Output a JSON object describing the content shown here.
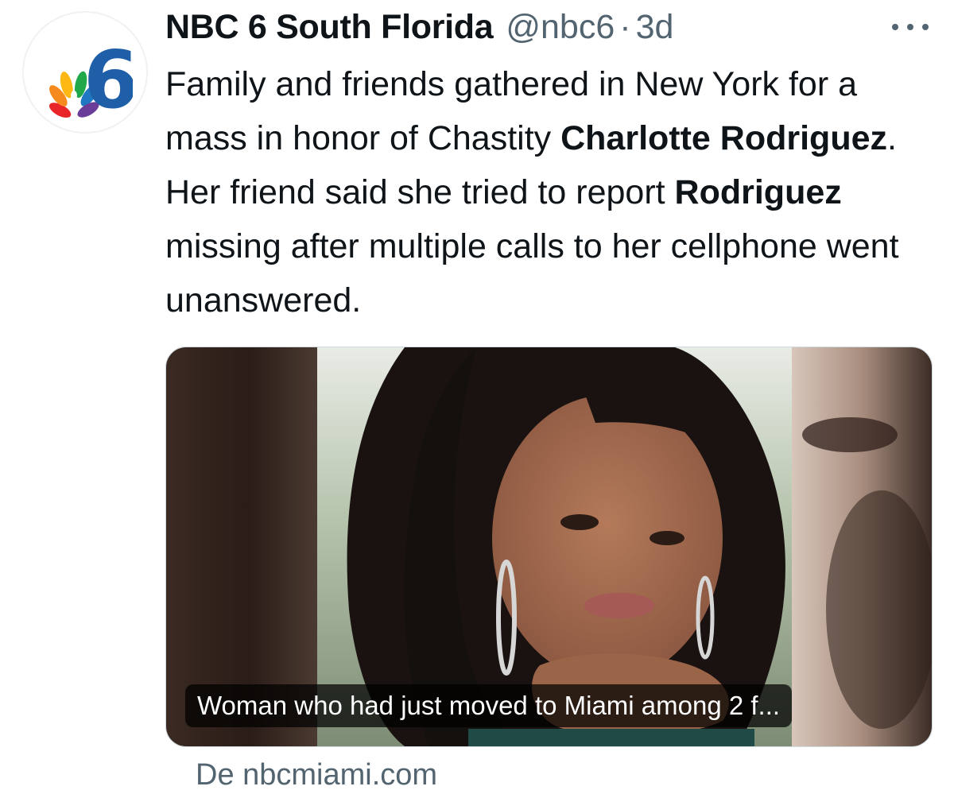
{
  "author": {
    "display_name": "NBC 6 South Florida",
    "handle": "@nbc6",
    "separator": "·",
    "time": "3d",
    "avatar_icon": "nbc6-peacock-logo-icon",
    "brand_color": "#1f5fa8"
  },
  "menu": {
    "icon": "more-dots-icon"
  },
  "tweet": {
    "text_1": "Family and friends gathered in New York for a mass in honor of Chastity ",
    "bold_1": "Charlotte Rodriguez",
    "text_2": ". Her friend said she tried to report ",
    "bold_2": "Rodriguez",
    "text_3": " missing after multiple calls to her cellphone went unanswered."
  },
  "card": {
    "caption": "Woman who had just moved to Miami among 2 f...",
    "source": "De nbcmiami.com",
    "image_icon": "portrait-photo-icon"
  }
}
